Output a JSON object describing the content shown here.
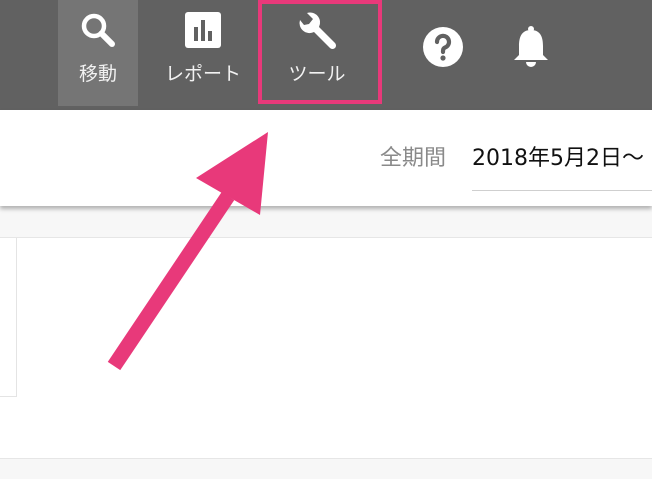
{
  "nav": {
    "items": [
      {
        "label": "移動",
        "icon": "search-icon"
      },
      {
        "label": "レポート",
        "icon": "bar-chart-icon"
      },
      {
        "label": "ツール",
        "icon": "wrench-icon"
      }
    ],
    "help_icon": "help-icon",
    "notification_icon": "bell-icon"
  },
  "date_range": {
    "label": "全期間",
    "value": "2018年5月2日〜"
  },
  "colors": {
    "nav_background": "#616161",
    "nav_active": "#757575",
    "highlight": "#e8397a",
    "arrow": "#e8397a"
  }
}
